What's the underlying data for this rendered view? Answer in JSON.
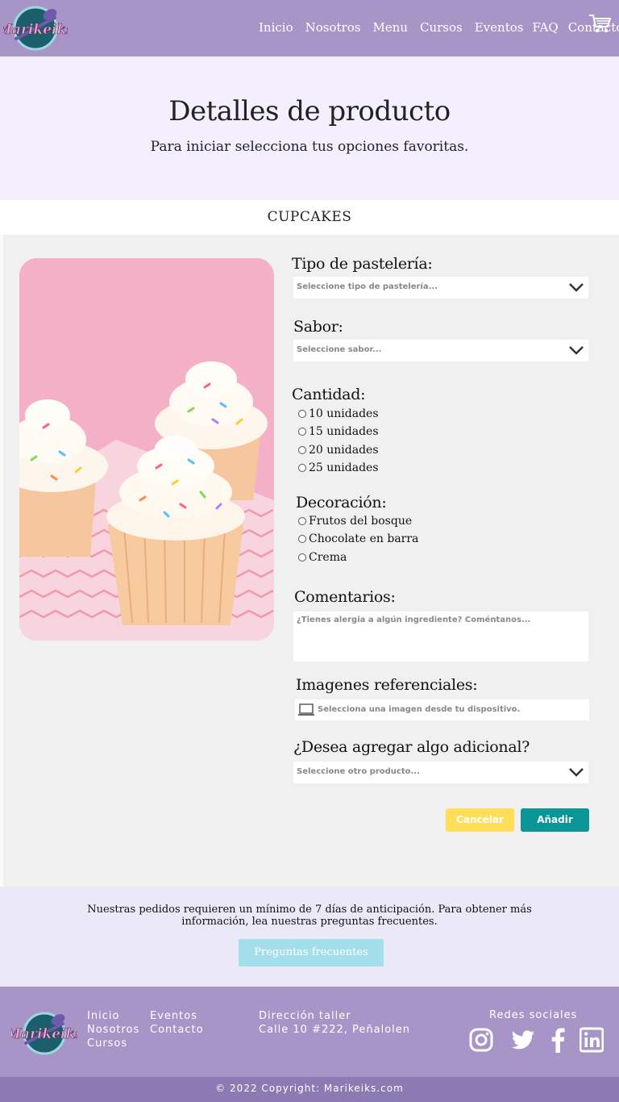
{
  "header": {
    "nav": [
      "Inicio",
      "Nosotros",
      "Menu",
      "Cursos",
      "Eventos",
      "FAQ",
      "Contacto"
    ]
  },
  "hero": {
    "title": "Detalles de producto",
    "subtitle": "Para iniciar selecciona tus opciones favoritas."
  },
  "product": {
    "name": "CUPCAKES"
  },
  "form": {
    "tipo_label": "Tipo de pastelería:",
    "tipo_placeholder": "Seleccione tipo de pastelería...",
    "sabor_label": "Sabor:",
    "sabor_placeholder": "Seleccione sabor...",
    "cantidad_label": "Cantidad:",
    "cantidad_options": [
      "10 unidades",
      "15 unidades",
      "20 unidades",
      "25 unidades"
    ],
    "decoracion_label": "Decoración:",
    "decoracion_options": [
      "Frutos del bosque",
      "Chocolate en barra",
      "Crema"
    ],
    "comentarios_label": "Comentarios:",
    "comentarios_placeholder": "¿Tienes alergia a algún ingrediente? Coméntanos...",
    "imagenes_label": "Imagenes referenciales:",
    "imagenes_placeholder": "Selecciona una imagen desde tu dispositivo.",
    "adicional_label": "¿Desea agregar algo adicional?",
    "adicional_placeholder": "Seleccione otro producto...",
    "cancel_label": "Cancelar",
    "add_label": "Añadir"
  },
  "notice": {
    "text": "Nuestras pedidos requieren un mínimo de 7 días de anticipación. Para obtener más información, lea nuestras preguntas frecuentes.",
    "button": "Preguntas frecuentes"
  },
  "footer": {
    "links_col1": [
      "Inicio",
      "Nosotros",
      "Cursos"
    ],
    "links_col2": [
      "Eventos",
      "Contacto"
    ],
    "address_title": "Dirección taller",
    "address": "Calle 10 #222, Peñalolen",
    "social_title": "Redes sociales",
    "social": [
      "instagram-icon",
      "twitter-icon",
      "facebook-icon",
      "linkedin-icon"
    ],
    "copyright": "© 2022 Copyright: Marikeiks.com"
  },
  "colors": {
    "header": "#a895c8",
    "hero_bg": "#f3efff",
    "cancel": "#ffde59",
    "add": "#0b9596",
    "faq_button": "#a3dfeb",
    "copyright_bar": "#8c7ab3"
  }
}
